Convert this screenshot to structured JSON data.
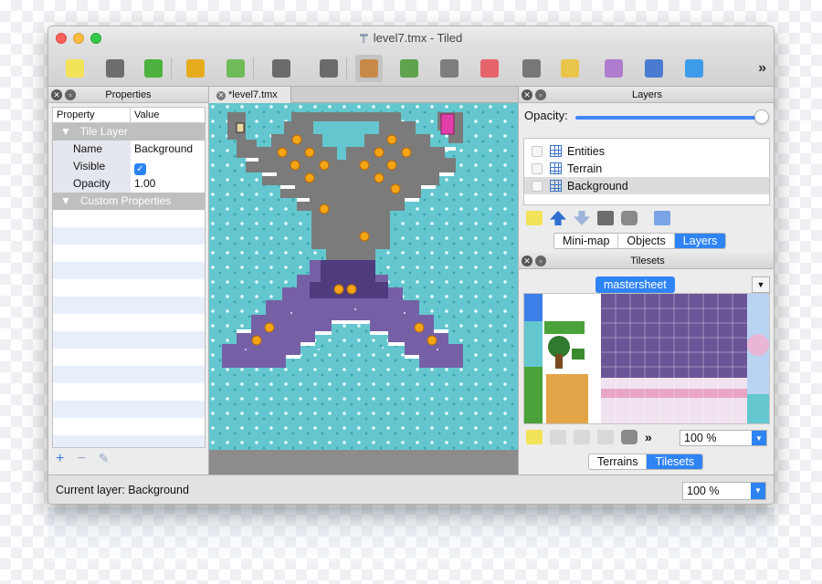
{
  "window": {
    "title": "level7.tmx - Tiled",
    "doc_icon": "document-icon"
  },
  "toolbar": {
    "buttons": [
      {
        "name": "new-map",
        "icon": "new-file-icon",
        "color": "#f3e35a"
      },
      {
        "name": "open",
        "icon": "folder-icon",
        "color": "#6d6d6d"
      },
      {
        "name": "save",
        "icon": "save-icon",
        "color": "#4db23f"
      },
      {
        "name": "undo",
        "icon": "undo-icon",
        "color": "#e6ac1e"
      },
      {
        "name": "redo",
        "icon": "redo-icon",
        "color": "#6fbb58"
      },
      {
        "name": "command",
        "icon": "gears-icon",
        "color": "#6a6a6a"
      },
      {
        "name": "random",
        "icon": "dice-icon",
        "color": "#6a6a6a"
      },
      {
        "name": "stamp",
        "icon": "stamp-icon",
        "color": "#c9894a"
      },
      {
        "name": "terrain",
        "icon": "terrain-brush-icon",
        "color": "#5fa34e"
      },
      {
        "name": "fill",
        "icon": "bucket-fill-icon",
        "color": "#7d7d7d"
      },
      {
        "name": "eraser",
        "icon": "eraser-icon",
        "color": "#e5646a"
      },
      {
        "name": "rect-select",
        "icon": "rect-select-icon",
        "color": "#777777"
      },
      {
        "name": "magic-wand",
        "icon": "magic-wand-icon",
        "color": "#e9c54c"
      },
      {
        "name": "select-same",
        "icon": "select-same-icon",
        "color": "#b07ccf"
      },
      {
        "name": "edit-polygon",
        "icon": "node-edit-icon",
        "color": "#4a7bd1"
      },
      {
        "name": "select-objects",
        "icon": "monitor-icon",
        "color": "#3d9be9"
      }
    ],
    "overflow": "»"
  },
  "properties": {
    "title": "Properties",
    "col_property": "Property",
    "col_value": "Value",
    "group_tile_layer": "Tile Layer",
    "rows": [
      {
        "key": "Name",
        "value": "Background"
      },
      {
        "key": "Visible",
        "value": "✓"
      },
      {
        "key": "Opacity",
        "value": "1.00"
      }
    ],
    "group_custom": "Custom Properties",
    "add": "+",
    "remove": "−",
    "edit": "✎"
  },
  "document": {
    "tab": "*level7.tmx"
  },
  "layers": {
    "title": "Layers",
    "opacity_label": "Opacity:",
    "opacity": 1.0,
    "items": [
      {
        "label": "Entities",
        "selected": false
      },
      {
        "label": "Terrain",
        "selected": false
      },
      {
        "label": "Background",
        "selected": true
      }
    ],
    "tabs": [
      "Mini-map",
      "Objects",
      "Layers"
    ],
    "active_tab": "Layers"
  },
  "tilesets": {
    "title": "Tilesets",
    "tileset_name": "mastersheet",
    "zoom": "100 %",
    "overflow": "»",
    "tabs": [
      "Terrains",
      "Tilesets"
    ],
    "active_tab": "Tilesets"
  },
  "status": {
    "current_layer": "Current layer: Background",
    "zoom": "100 %"
  },
  "colors": {
    "accent": "#2f84f5",
    "water": "#64c7cf",
    "cave": "#7c7c7c",
    "purple": "#5f4c8c",
    "coin": "#f4a516"
  }
}
